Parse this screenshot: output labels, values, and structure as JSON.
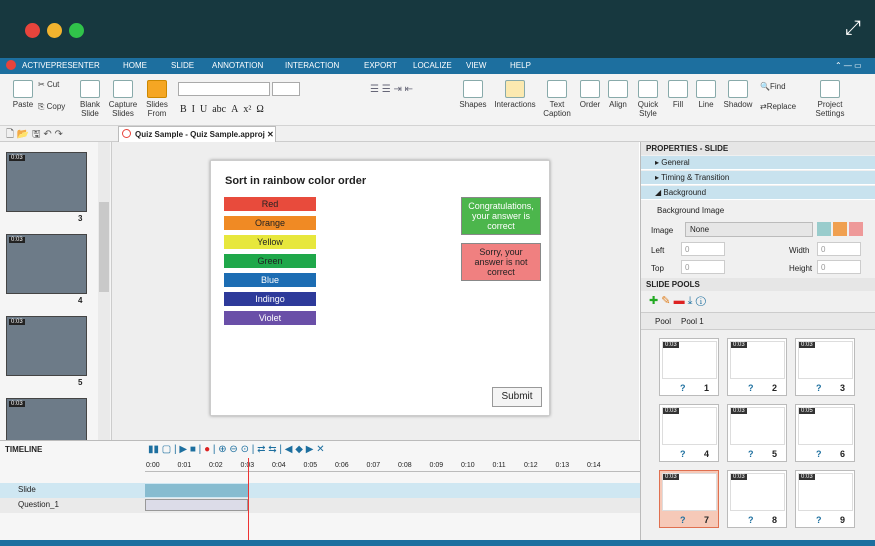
{
  "window": {
    "dots": [
      "#e8443c",
      "#f2b32e",
      "#30c24a"
    ],
    "expand_glyph": "⤢"
  },
  "menu": {
    "app": "ACTIVEPRESENTER",
    "tabs": [
      "HOME",
      "SLIDE",
      "ANNOTATION",
      "INTERACTION",
      "EXPORT",
      "LOCALIZE",
      "VIEW",
      "HELP"
    ],
    "win_controls": "⌃ — ▭"
  },
  "ribbon": {
    "cut": "Cut",
    "paste": "Paste",
    "copy": "Copy",
    "blank_slide": "Blank Slide",
    "capture_slides": "Capture Slides",
    "slides_from": "Slides From",
    "shapes": "Shapes",
    "interactions": "Interactions",
    "text_caption": "Text Caption",
    "order": "Order",
    "align": "Align",
    "quick_style": "Quick Style",
    "fill": "Fill",
    "line": "Line",
    "shadow": "Shadow",
    "find": "Find",
    "replace": "Replace",
    "project_settings": "Project Settings"
  },
  "doc_tab": {
    "title": "Quiz Sample - Quiz Sample.approj"
  },
  "thumbs": [
    {
      "time": "0:03",
      "num": "3"
    },
    {
      "time": "0:03",
      "num": "4"
    },
    {
      "time": "0:03",
      "num": "5"
    },
    {
      "time": "0:03",
      "num": ""
    }
  ],
  "slide": {
    "title": "Sort in rainbow color order",
    "colors": [
      {
        "label": "Red",
        "bg": "#e84b3c"
      },
      {
        "label": "Orange",
        "bg": "#f08a24"
      },
      {
        "label": "Yellow",
        "bg": "#e7e73c"
      },
      {
        "label": "Green",
        "bg": "#1fa84a"
      },
      {
        "label": "Blue",
        "bg": "#1c6db3"
      },
      {
        "label": "Indingo",
        "bg": "#2d3a9a"
      },
      {
        "label": "Violet",
        "bg": "#6a4fa8"
      }
    ],
    "correct": "Congratulations, your answer is correct",
    "incorrect": "Sorry, your answer is not correct",
    "submit": "Submit"
  },
  "properties": {
    "header": "PROPERTIES - SLIDE",
    "general": "General",
    "timing": "Timing & Transition",
    "background": "Background",
    "bg_image": "Background Image",
    "image_label": "Image",
    "image_value": "None",
    "left_label": "Left",
    "left_value": "0",
    "top_label": "Top",
    "top_value": "0",
    "width_label": "Width",
    "width_value": "0",
    "height_label": "Height",
    "height_value": "0"
  },
  "pools": {
    "header": "SLIDE POOLS",
    "pool_label": "Pool",
    "pool_value": "Pool 1",
    "items": [
      {
        "time": "0:03",
        "n": "1"
      },
      {
        "time": "0:03",
        "n": "2"
      },
      {
        "time": "0:03",
        "n": "3"
      },
      {
        "time": "0:03",
        "n": "4"
      },
      {
        "time": "0:03",
        "n": "5"
      },
      {
        "time": "0:05",
        "n": "6"
      },
      {
        "time": "0:03",
        "n": "7"
      },
      {
        "time": "0:03",
        "n": "8"
      },
      {
        "time": "0:03",
        "n": "9"
      }
    ],
    "q": "?"
  },
  "timeline": {
    "header": "TIMELINE",
    "ticks": [
      "0:00",
      "0:01",
      "0:02",
      "0:03",
      "0:04",
      "0:05",
      "0:06",
      "0:07",
      "0:08",
      "0:09",
      "0:10",
      "0:11",
      "0:12",
      "0:13",
      "0:14"
    ],
    "row1": "Slide",
    "row2": "Question_1"
  }
}
